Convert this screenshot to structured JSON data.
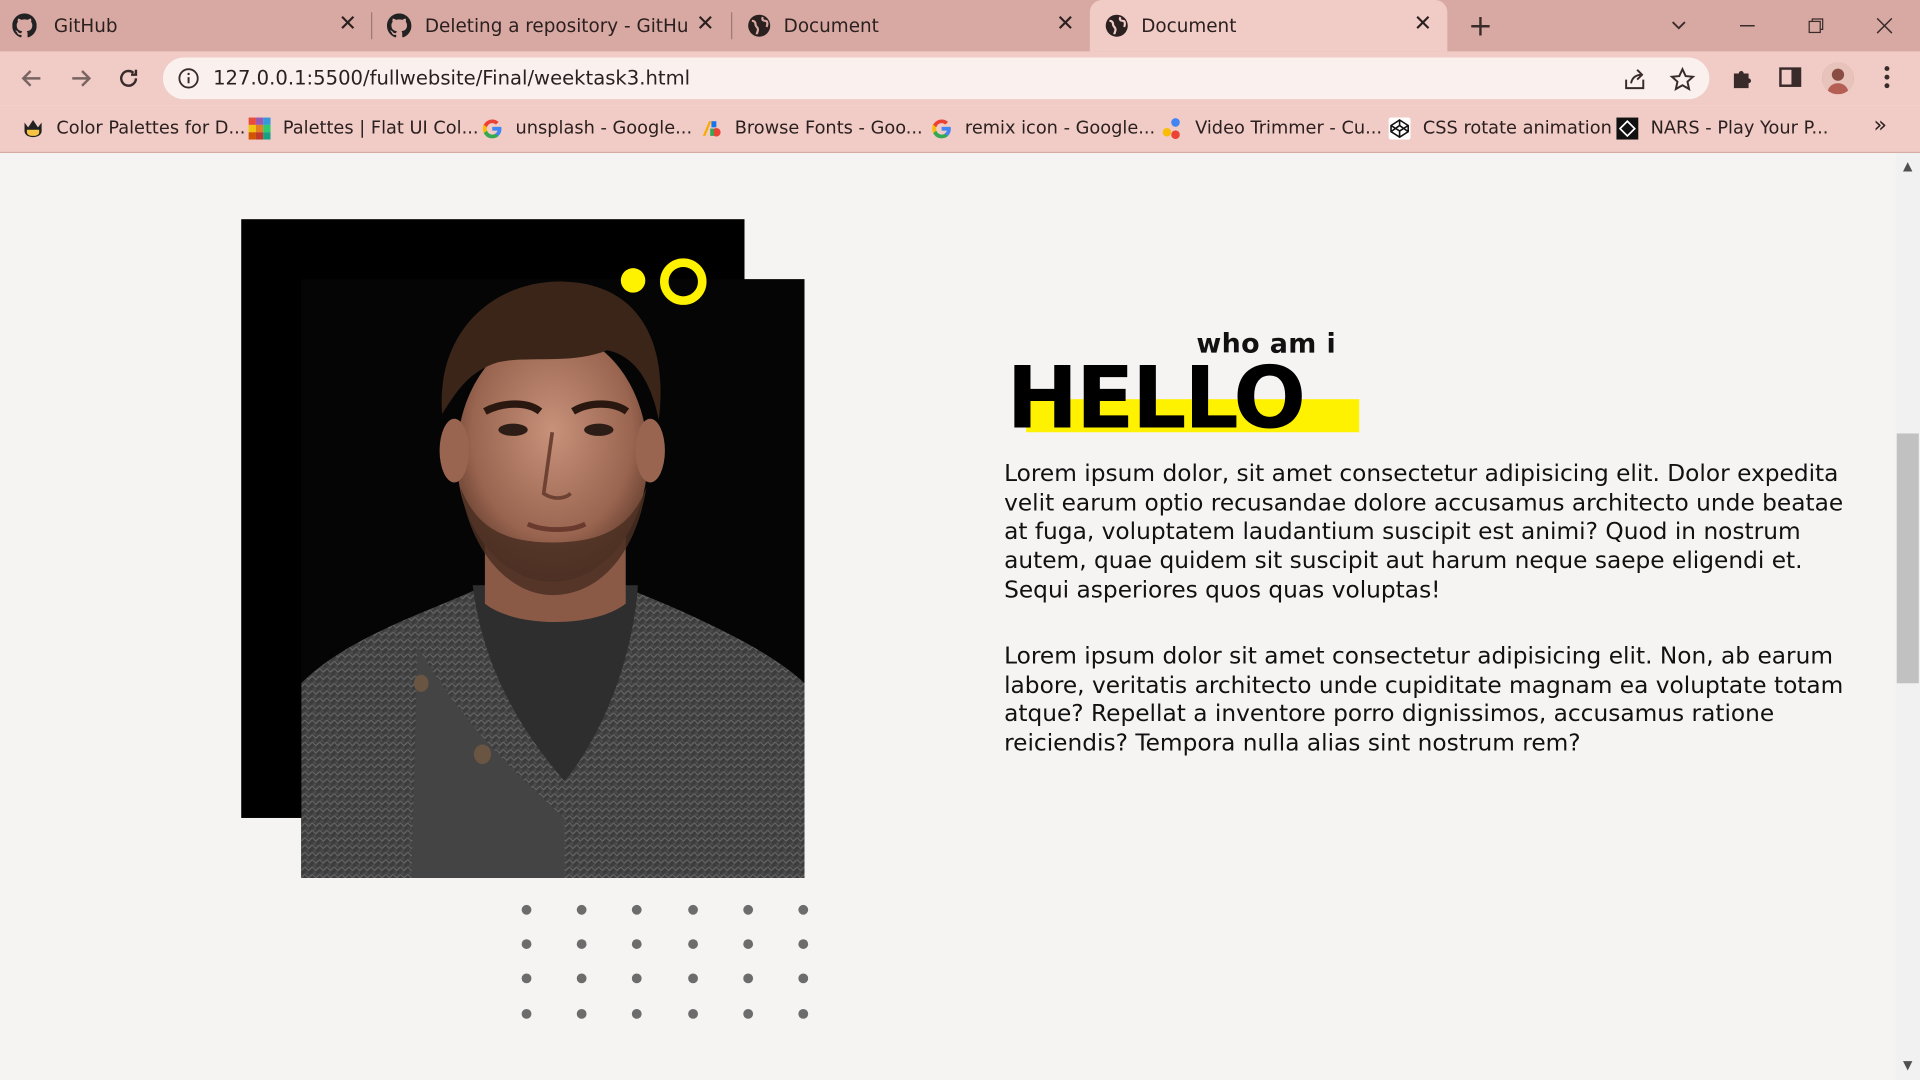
{
  "browser": {
    "tabs": [
      {
        "title": "GitHub",
        "icon": "github-icon",
        "active": false
      },
      {
        "title": "Deleting a repository - GitHub Do",
        "icon": "github-icon",
        "active": false
      },
      {
        "title": "Document",
        "icon": "globe-icon",
        "active": false
      },
      {
        "title": "Document",
        "icon": "globe-icon",
        "active": true
      }
    ],
    "new_tab_glyph": "+",
    "close_glyph": "✕",
    "url": "127.0.0.1:5500/fullwebsite/Final/weektask3.html",
    "bookmarks": [
      {
        "label": "Color Palettes for D...",
        "icon": "palette-crown-icon"
      },
      {
        "label": "Palettes | Flat UI Col...",
        "icon": "flat-ui-icon"
      },
      {
        "label": "unsplash - Google...",
        "icon": "google-icon"
      },
      {
        "label": "Browse Fonts - Goo...",
        "icon": "google-fonts-icon"
      },
      {
        "label": "remix icon - Google...",
        "icon": "google-icon"
      },
      {
        "label": "Video Trimmer - Cu...",
        "icon": "video-trimmer-icon"
      },
      {
        "label": "CSS rotate animation",
        "icon": "codepen-icon"
      },
      {
        "label": "NARS - Play Your P...",
        "icon": "nars-icon"
      }
    ],
    "bookmarks_more_glyph": "»"
  },
  "page": {
    "kicker": "who am i",
    "headline": "HELLO",
    "paragraphs": [
      "Lorem ipsum dolor, sit amet consectetur adipisicing elit. Dolor expedita velit earum optio recusandae dolore accusamus architecto unde beatae at fuga, voluptatem laudantium suscipit est animi? Quod in nostrum autem, quae quidem sit suscipit aut harum neque saepe eligendi et. Sequi asperiores quos quas voluptas!",
      "Lorem ipsum dolor sit amet consectetur adipisicing elit. Non, ab earum labore, veritatis architecto unde cupiditate magnam ea voluptate totam atque? Repellat a inventore porro dignissimos, accusamus ratione reiciendis? Tempora nulla alias sint nostrum rem?"
    ],
    "accent_color": "#fff200",
    "text_color": "#111111",
    "background_color": "#f6f3f3",
    "browser_chrome_color": "#f1cbc5"
  }
}
